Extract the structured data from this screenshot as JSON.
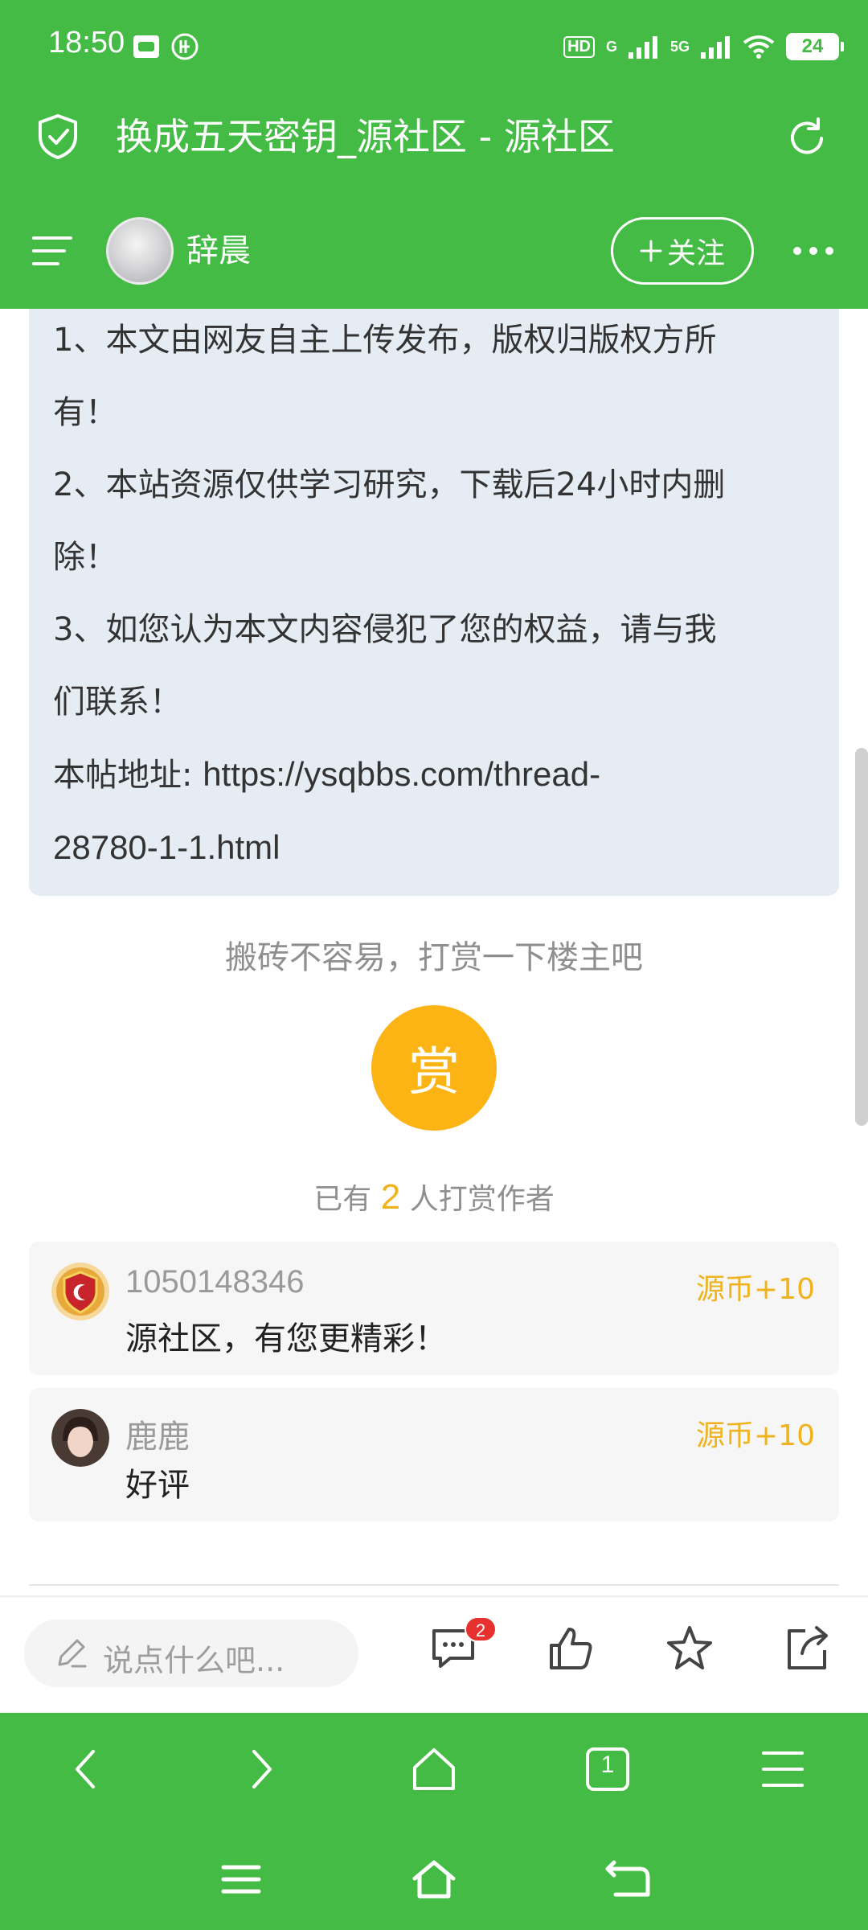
{
  "status_bar": {
    "time": "18:50",
    "network_hd": "HD",
    "network_g": "G",
    "network_5g": "5G",
    "battery": "24"
  },
  "header": {
    "title": "换成五天密钥_源社区 - 源社区"
  },
  "author": {
    "name": "辞晨",
    "follow_label": "关注"
  },
  "notice": {
    "lines": [
      "1、本文由网友自主上传发布，版权归版权方所",
      "有！",
      "2、本站资源仅供学习研究，下载后24小时内删",
      "除！",
      "3、如您认为本文内容侵犯了您的权益，请与我",
      "们联系！"
    ],
    "url_label": "本帖地址:",
    "url_line1": "https://ysqbbs.com/thread-",
    "url_line2": "28780-1-1.html"
  },
  "reward": {
    "hint": "搬砖不容易，打赏一下楼主吧",
    "button_label": "赏",
    "count_prefix": "已有",
    "count": "2",
    "count_suffix": "人打赏作者",
    "items": [
      {
        "name": "1050148346",
        "message": "源社区，有您更精彩！",
        "reward": "源币+10"
      },
      {
        "name": "鹿鹿",
        "message": "好评",
        "reward": "源币+10"
      }
    ]
  },
  "comment_bar": {
    "placeholder": "说点什么吧...",
    "comment_count": "2"
  },
  "colors": {
    "brand_green": "#44bb44",
    "reward_gold": "#fbb414",
    "badge_red": "#e6312f"
  },
  "icons": {
    "header": [
      "shield-check-icon",
      "refresh-icon",
      "menu-icon",
      "more-icon"
    ],
    "comment_bar": [
      "pencil-icon",
      "comment-icon",
      "like-icon",
      "star-icon",
      "share-icon"
    ],
    "browser_nav": [
      "back-icon",
      "forward-icon",
      "home-icon",
      "tabs-icon",
      "menu-icon"
    ],
    "system_nav": [
      "recents-icon",
      "home-icon",
      "back-icon"
    ]
  },
  "browser_nav": {
    "tab_count": "1"
  }
}
